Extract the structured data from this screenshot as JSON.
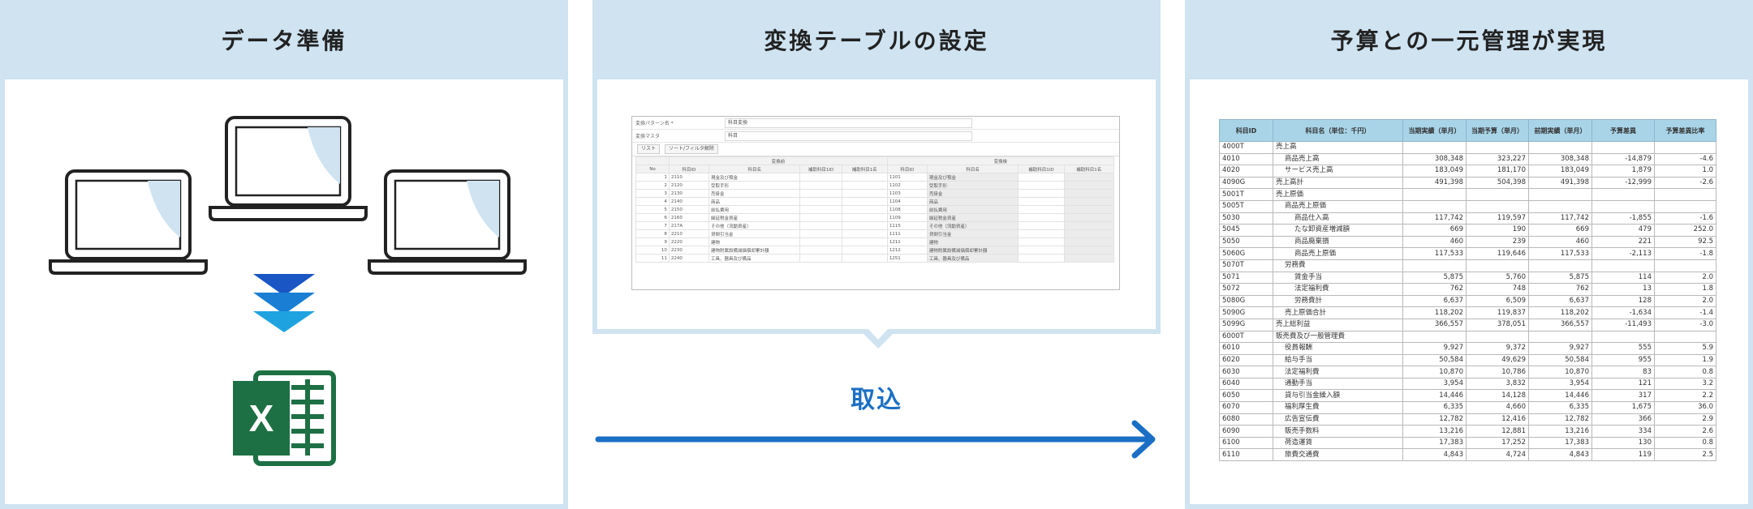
{
  "panels": {
    "left_title": "データ準備",
    "center_title": "変換テーブルの設定",
    "right_title": "予算との一元管理が実現"
  },
  "import_label": "取込",
  "colors": {
    "panel": "#cfe3f1",
    "arrow": "#1a6fc4",
    "excel": "#1d7044",
    "table_header": "#a9d4e8"
  },
  "mini_app": {
    "pattern_label": "変換パターン名 *",
    "pattern_value": "科目変換",
    "mask_label": "変換マスタ",
    "mask_value": "科目",
    "tab_list": "リスト",
    "tab_sort": "ソート/フィルタ解除",
    "group_before": "変換前",
    "group_after": "変換後",
    "headers": [
      "No",
      "科目ID",
      "科目名",
      "補助科目1ID",
      "補助科目1名",
      "科目ID",
      "科目名",
      "補助科目1ID",
      "補助科目1名"
    ],
    "rows": [
      [
        "1",
        "2110",
        "現金及び預金",
        "1101",
        "現金及び預金"
      ],
      [
        "2",
        "2120",
        "受取手形",
        "1102",
        "受取手形"
      ],
      [
        "3",
        "2130",
        "売掛金",
        "1103",
        "売掛金"
      ],
      [
        "4",
        "2140",
        "商品",
        "1104",
        "商品"
      ],
      [
        "5",
        "2150",
        "前払費用",
        "1108",
        "前払費用"
      ],
      [
        "6",
        "2160",
        "繰延税金資産",
        "1109",
        "繰延税金資産"
      ],
      [
        "7",
        "217A",
        "その他（流動資産）",
        "1115",
        "その他（流動資産）"
      ],
      [
        "8",
        "2210",
        "貸倒引当金",
        "1111",
        "貸倒引当金"
      ],
      [
        "9",
        "2220",
        "建物",
        "1211",
        "建物"
      ],
      [
        "10",
        "2230",
        "建物附属設備減価償却累計額",
        "1212",
        "建物附属設備減価償却累計額"
      ],
      [
        "11",
        "2240",
        "工具、器具及び備品",
        "1251",
        "工具、器具及び備品"
      ]
    ]
  },
  "budget": {
    "headers": [
      "科目ID",
      "科目名（単位：千円）",
      "当期実績（単月）",
      "当期予算（単月）",
      "前期実績（単月）",
      "予算差異",
      "予算差異比率"
    ],
    "rows": [
      [
        "4000T",
        "売上高",
        "",
        "",
        "",
        "",
        "",
        0
      ],
      [
        "4010",
        "商品売上高",
        "308,348",
        "323,227",
        "308,348",
        "-14,879",
        "-4.6",
        1
      ],
      [
        "4020",
        "サービス売上高",
        "183,049",
        "181,170",
        "183,049",
        "1,879",
        "1.0",
        1
      ],
      [
        "4090G",
        "売上高計",
        "491,398",
        "504,398",
        "491,398",
        "-12,999",
        "-2.6",
        0
      ],
      [
        "5001T",
        "売上原価",
        "",
        "",
        "",
        "",
        "",
        0
      ],
      [
        "5005T",
        "商品売上原価",
        "",
        "",
        "",
        "",
        "",
        1
      ],
      [
        "5030",
        "商品仕入高",
        "117,742",
        "119,597",
        "117,742",
        "-1,855",
        "-1.6",
        2
      ],
      [
        "5045",
        "たな卸資産増減額",
        "669",
        "190",
        "669",
        "479",
        "252.0",
        2
      ],
      [
        "5050",
        "商品廃棄損",
        "460",
        "239",
        "460",
        "221",
        "92.5",
        2
      ],
      [
        "5060G",
        "商品売上原価",
        "117,533",
        "119,646",
        "117,533",
        "-2,113",
        "-1.8",
        2
      ],
      [
        "5070T",
        "労務費",
        "",
        "",
        "",
        "",
        "",
        1
      ],
      [
        "5071",
        "賃金手当",
        "5,875",
        "5,760",
        "5,875",
        "114",
        "2.0",
        2
      ],
      [
        "5072",
        "法定福利費",
        "762",
        "748",
        "762",
        "13",
        "1.8",
        2
      ],
      [
        "5080G",
        "労務費計",
        "6,637",
        "6,509",
        "6,637",
        "128",
        "2.0",
        2
      ],
      [
        "5090G",
        "売上原価合計",
        "118,202",
        "119,837",
        "118,202",
        "-1,634",
        "-1.4",
        1
      ],
      [
        "5099G",
        "売上総利益",
        "366,557",
        "378,051",
        "366,557",
        "-11,493",
        "-3.0",
        0
      ],
      [
        "6000T",
        "販売費及び一般管理費",
        "",
        "",
        "",
        "",
        "",
        0
      ],
      [
        "6010",
        "役員報酬",
        "9,927",
        "9,372",
        "9,927",
        "555",
        "5.9",
        1
      ],
      [
        "6020",
        "給与手当",
        "50,584",
        "49,629",
        "50,584",
        "955",
        "1.9",
        1
      ],
      [
        "6030",
        "法定福利費",
        "10,870",
        "10,786",
        "10,870",
        "83",
        "0.8",
        1
      ],
      [
        "6040",
        "通勤手当",
        "3,954",
        "3,832",
        "3,954",
        "121",
        "3.2",
        1
      ],
      [
        "6050",
        "貸与引当金繰入額",
        "14,446",
        "14,128",
        "14,446",
        "317",
        "2.2",
        1
      ],
      [
        "6070",
        "福利厚生費",
        "6,335",
        "4,660",
        "6,335",
        "1,675",
        "36.0",
        1
      ],
      [
        "6080",
        "広告宣伝費",
        "12,782",
        "12,416",
        "12,782",
        "366",
        "2.9",
        1
      ],
      [
        "6090",
        "販売手数料",
        "13,216",
        "12,881",
        "13,216",
        "334",
        "2.6",
        1
      ],
      [
        "6100",
        "荷造運賃",
        "17,383",
        "17,252",
        "17,383",
        "130",
        "0.8",
        1
      ],
      [
        "6110",
        "旅費交通費",
        "4,843",
        "4,724",
        "4,843",
        "119",
        "2.5",
        1
      ]
    ]
  },
  "icons": {
    "excel_letter": "X"
  }
}
